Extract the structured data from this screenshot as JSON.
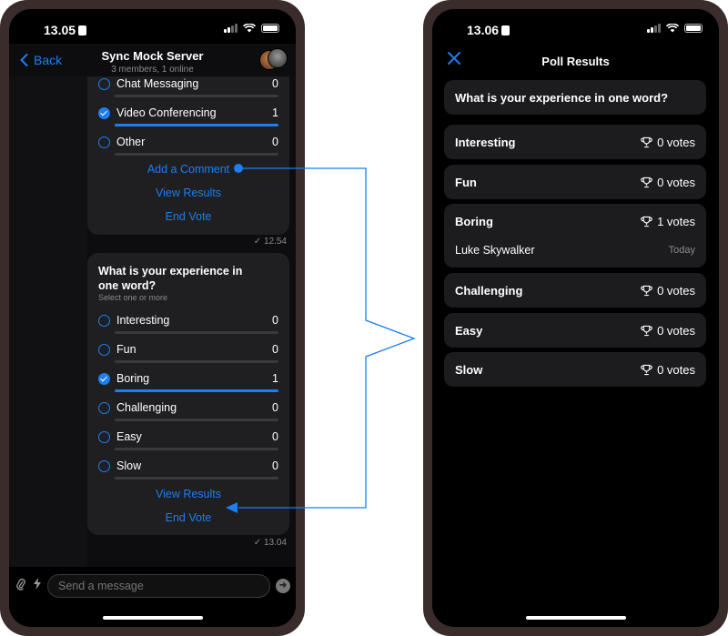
{
  "left": {
    "status_time": "13.05",
    "back_label": "Back",
    "chat_title": "Sync Mock Server",
    "chat_subtitle": "3 members, 1 online",
    "poll1": {
      "options": [
        {
          "label": "Chat Messaging",
          "count": "0",
          "selected": false,
          "fraction": 0
        },
        {
          "label": "Video Conferencing",
          "count": "1",
          "selected": true,
          "fraction": 1
        },
        {
          "label": "Other",
          "count": "0",
          "selected": false,
          "fraction": 0
        }
      ],
      "add_comment": "Add a Comment",
      "view_results": "View Results",
      "end_vote": "End Vote",
      "timestamp": "12.54"
    },
    "poll2": {
      "question": "What is your experience in one word?",
      "hint": "Select one or more",
      "options": [
        {
          "label": "Interesting",
          "count": "0",
          "selected": false,
          "fraction": 0
        },
        {
          "label": "Fun",
          "count": "0",
          "selected": false,
          "fraction": 0
        },
        {
          "label": "Boring",
          "count": "1",
          "selected": true,
          "fraction": 1
        },
        {
          "label": "Challenging",
          "count": "0",
          "selected": false,
          "fraction": 0
        },
        {
          "label": "Easy",
          "count": "0",
          "selected": false,
          "fraction": 0
        },
        {
          "label": "Slow",
          "count": "0",
          "selected": false,
          "fraction": 0
        }
      ],
      "view_results": "View Results",
      "end_vote": "End Vote",
      "timestamp": "13.04"
    },
    "composer_placeholder": "Send a message"
  },
  "right": {
    "status_time": "13.06",
    "title": "Poll Results",
    "question": "What is your experience in one word?",
    "results": [
      {
        "label": "Interesting",
        "votes": "0 votes"
      },
      {
        "label": "Fun",
        "votes": "0 votes"
      },
      {
        "label": "Boring",
        "votes": "1 votes",
        "voter": "Luke Skywalker",
        "voter_date": "Today"
      },
      {
        "label": "Challenging",
        "votes": "0 votes"
      },
      {
        "label": "Easy",
        "votes": "0 votes"
      },
      {
        "label": "Slow",
        "votes": "0 votes"
      }
    ]
  },
  "colors": {
    "accent": "#1c7ef0",
    "card": "#1c1c1e",
    "bubble": "#1f1f22"
  }
}
